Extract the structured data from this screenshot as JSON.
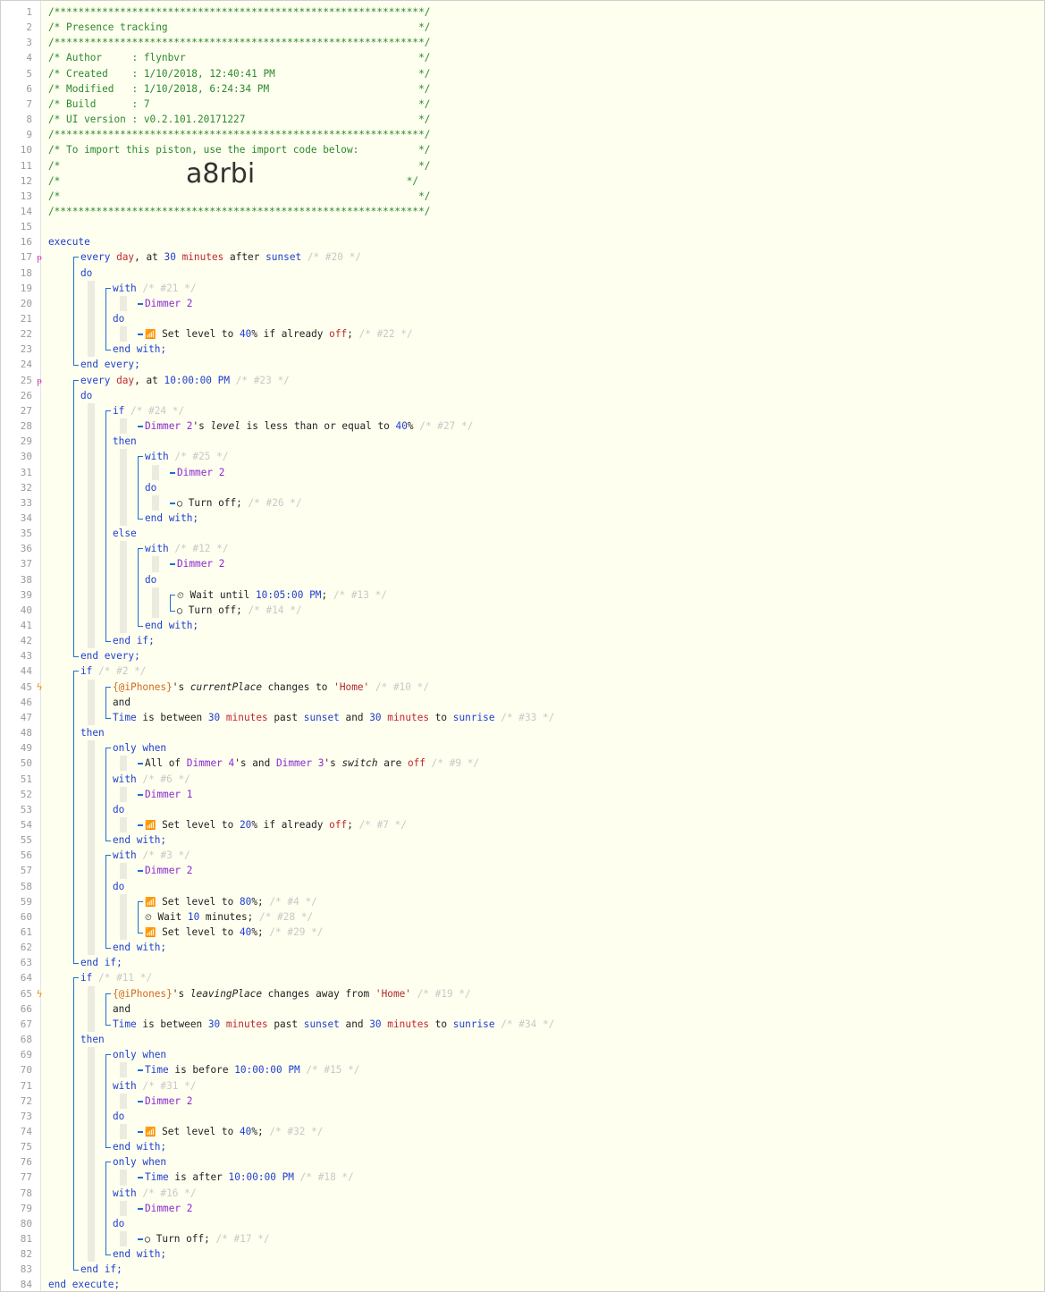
{
  "colors": {
    "bg": "#fffff0",
    "comment": "#2a8a2a",
    "keyword": "#1f3fcf",
    "device": "#8a2ad0",
    "value": "#c0272d",
    "variable": "#d06a1c",
    "dim": "#c8c8c8",
    "bracket": "#1f6fcf"
  },
  "import_code": "a8rbi",
  "lines": [
    {
      "n": "1",
      "i": 0,
      "t": [
        [
          "cm",
          "/**************************************************************/"
        ]
      ]
    },
    {
      "n": "2",
      "i": 0,
      "t": [
        [
          "cm",
          "/* Presence tracking                                          */"
        ]
      ]
    },
    {
      "n": "3",
      "i": 0,
      "t": [
        [
          "cm",
          "/**************************************************************/"
        ]
      ]
    },
    {
      "n": "4",
      "i": 0,
      "t": [
        [
          "cm",
          "/* Author     : flynbvr                                       */"
        ]
      ]
    },
    {
      "n": "5",
      "i": 0,
      "t": [
        [
          "cm",
          "/* Created    : 1/10/2018, 12:40:41 PM                        */"
        ]
      ]
    },
    {
      "n": "6",
      "i": 0,
      "t": [
        [
          "cm",
          "/* Modified   : 1/10/2018, 6:24:34 PM                         */"
        ]
      ]
    },
    {
      "n": "7",
      "i": 0,
      "t": [
        [
          "cm",
          "/* Build      : 7                                             */"
        ]
      ]
    },
    {
      "n": "8",
      "i": 0,
      "t": [
        [
          "cm",
          "/* UI version : v0.2.101.20171227                             */"
        ]
      ]
    },
    {
      "n": "9",
      "i": 0,
      "t": [
        [
          "cm",
          "/**************************************************************/"
        ]
      ]
    },
    {
      "n": "10",
      "i": 0,
      "t": [
        [
          "cm",
          "/* To import this piston, use the import code below:          */"
        ]
      ]
    },
    {
      "n": "11",
      "i": 0,
      "t": [
        [
          "cm",
          "/*                                                            */"
        ]
      ]
    },
    {
      "n": "12",
      "i": 0,
      "big": true,
      "t": [
        [
          "cm",
          "/*"
        ],
        [
          "cm",
          "                                                          */"
        ]
      ]
    },
    {
      "n": "13",
      "i": 0,
      "t": [
        [
          "cm",
          "/*                                                            */"
        ]
      ]
    },
    {
      "n": "14",
      "i": 0,
      "t": [
        [
          "cm",
          "/**************************************************************/"
        ]
      ]
    },
    {
      "n": "15",
      "i": 0,
      "t": []
    },
    {
      "n": "16",
      "i": 0,
      "t": [
        [
          "kw",
          "execute"
        ]
      ]
    },
    {
      "n": "17",
      "i": 1,
      "m": "p",
      "t": [
        [
          "kw",
          "every "
        ],
        [
          "val",
          "day"
        ],
        [
          "txt",
          ", at "
        ],
        [
          "num",
          "30"
        ],
        [
          "txt",
          " "
        ],
        [
          "val",
          "minutes"
        ],
        [
          "txt",
          " after "
        ],
        [
          "kw",
          "sunset"
        ],
        [
          "dim",
          " /* #20 */"
        ]
      ]
    },
    {
      "n": "18",
      "i": 1,
      "t": [
        [
          "kw",
          "do"
        ]
      ]
    },
    {
      "n": "19",
      "i": 2,
      "t": [
        [
          "kw",
          "with"
        ],
        [
          "dim",
          " /* #21 */"
        ]
      ]
    },
    {
      "n": "20",
      "i": 3,
      "t": [
        [
          "dev",
          "Dimmer 2"
        ]
      ]
    },
    {
      "n": "21",
      "i": 2,
      "t": [
        [
          "kw",
          "do"
        ]
      ]
    },
    {
      "n": "22",
      "i": 3,
      "t": [
        [
          "ico",
          "📶"
        ],
        [
          "txt",
          " Set level to "
        ],
        [
          "num",
          "40"
        ],
        [
          "txt",
          "% if already "
        ],
        [
          "val",
          "off"
        ],
        [
          "txt",
          ";"
        ],
        [
          "dim",
          " /* #22 */"
        ]
      ]
    },
    {
      "n": "23",
      "i": 2,
      "t": [
        [
          "kw",
          "end with;"
        ]
      ]
    },
    {
      "n": "24",
      "i": 1,
      "t": [
        [
          "kw",
          "end every;"
        ]
      ]
    },
    {
      "n": "25",
      "i": 1,
      "m": "p",
      "t": [
        [
          "kw",
          "every "
        ],
        [
          "val",
          "day"
        ],
        [
          "txt",
          ", at "
        ],
        [
          "num",
          "10:00:00 PM"
        ],
        [
          "dim",
          " /* #23 */"
        ]
      ]
    },
    {
      "n": "26",
      "i": 1,
      "t": [
        [
          "kw",
          "do"
        ]
      ]
    },
    {
      "n": "27",
      "i": 2,
      "t": [
        [
          "kw",
          "if"
        ],
        [
          "dim",
          " /* #24 */"
        ]
      ]
    },
    {
      "n": "28",
      "i": 3,
      "t": [
        [
          "dev",
          "Dimmer 2"
        ],
        [
          "txt",
          "'s "
        ],
        [
          "attr",
          "level"
        ],
        [
          "txt",
          " is less than or equal to "
        ],
        [
          "num",
          "40"
        ],
        [
          "txt",
          "%"
        ],
        [
          "dim",
          " /* #27 */"
        ]
      ]
    },
    {
      "n": "29",
      "i": 2,
      "t": [
        [
          "kw",
          "then"
        ]
      ]
    },
    {
      "n": "30",
      "i": 3,
      "t": [
        [
          "kw",
          "with"
        ],
        [
          "dim",
          " /* #25 */"
        ]
      ]
    },
    {
      "n": "31",
      "i": 4,
      "t": [
        [
          "dev",
          "Dimmer 2"
        ]
      ]
    },
    {
      "n": "32",
      "i": 3,
      "t": [
        [
          "kw",
          "do"
        ]
      ]
    },
    {
      "n": "33",
      "i": 4,
      "t": [
        [
          "ico",
          "◯"
        ],
        [
          "txt",
          " Turn off;"
        ],
        [
          "dim",
          " /* #26 */"
        ]
      ]
    },
    {
      "n": "34",
      "i": 3,
      "t": [
        [
          "kw",
          "end with;"
        ]
      ]
    },
    {
      "n": "35",
      "i": 2,
      "t": [
        [
          "kw",
          "else"
        ]
      ]
    },
    {
      "n": "36",
      "i": 3,
      "t": [
        [
          "kw",
          "with"
        ],
        [
          "dim",
          " /* #12 */"
        ]
      ]
    },
    {
      "n": "37",
      "i": 4,
      "t": [
        [
          "dev",
          "Dimmer 2"
        ]
      ]
    },
    {
      "n": "38",
      "i": 3,
      "t": [
        [
          "kw",
          "do"
        ]
      ]
    },
    {
      "n": "39",
      "i": 4,
      "t": [
        [
          "ico",
          "⏲"
        ],
        [
          "txt",
          " Wait until "
        ],
        [
          "num",
          "10:05:00 PM"
        ],
        [
          "txt",
          ";"
        ],
        [
          "dim",
          " /* #13 */"
        ]
      ]
    },
    {
      "n": "40",
      "i": 4,
      "t": [
        [
          "ico",
          "◯"
        ],
        [
          "txt",
          " Turn off;"
        ],
        [
          "dim",
          " /* #14 */"
        ]
      ]
    },
    {
      "n": "41",
      "i": 3,
      "t": [
        [
          "kw",
          "end with;"
        ]
      ]
    },
    {
      "n": "42",
      "i": 2,
      "t": [
        [
          "kw",
          "end if;"
        ]
      ]
    },
    {
      "n": "43",
      "i": 1,
      "t": [
        [
          "kw",
          "end every;"
        ]
      ]
    },
    {
      "n": "44",
      "i": 1,
      "t": [
        [
          "kw",
          "if"
        ],
        [
          "dim",
          " /* #2 */"
        ]
      ]
    },
    {
      "n": "45",
      "i": 2,
      "m": "bolt",
      "t": [
        [
          "var",
          "{@iPhones}"
        ],
        [
          "txt",
          "'s "
        ],
        [
          "attr",
          "currentPlace"
        ],
        [
          "txt",
          " changes to "
        ],
        [
          "str",
          "'Home'"
        ],
        [
          "dim",
          " /* #10 */"
        ]
      ]
    },
    {
      "n": "46",
      "i": 2,
      "t": [
        [
          "txt",
          "and"
        ]
      ]
    },
    {
      "n": "47",
      "i": 2,
      "t": [
        [
          "kw",
          "Time"
        ],
        [
          "txt",
          " is between "
        ],
        [
          "num",
          "30"
        ],
        [
          "txt",
          " "
        ],
        [
          "val",
          "minutes"
        ],
        [
          "txt",
          " past "
        ],
        [
          "kw",
          "sunset"
        ],
        [
          "txt",
          " and "
        ],
        [
          "num",
          "30"
        ],
        [
          "txt",
          " "
        ],
        [
          "val",
          "minutes"
        ],
        [
          "txt",
          " to "
        ],
        [
          "kw",
          "sunrise"
        ],
        [
          "dim",
          " /* #33 */"
        ]
      ]
    },
    {
      "n": "48",
      "i": 1,
      "t": [
        [
          "kw",
          "then"
        ]
      ]
    },
    {
      "n": "49",
      "i": 2,
      "t": [
        [
          "kw",
          "only when"
        ]
      ]
    },
    {
      "n": "50",
      "i": 3,
      "t": [
        [
          "txt",
          "All of "
        ],
        [
          "dev",
          "Dimmer 4"
        ],
        [
          "txt",
          "'s and "
        ],
        [
          "dev",
          "Dimmer 3"
        ],
        [
          "txt",
          "'s "
        ],
        [
          "attr",
          "switch"
        ],
        [
          "txt",
          " are "
        ],
        [
          "val",
          "off"
        ],
        [
          "dim",
          " /* #9 */"
        ]
      ]
    },
    {
      "n": "51",
      "i": 2,
      "t": [
        [
          "kw",
          "with"
        ],
        [
          "dim",
          " /* #6 */"
        ]
      ]
    },
    {
      "n": "52",
      "i": 3,
      "t": [
        [
          "dev",
          "Dimmer 1"
        ]
      ]
    },
    {
      "n": "53",
      "i": 2,
      "t": [
        [
          "kw",
          "do"
        ]
      ]
    },
    {
      "n": "54",
      "i": 3,
      "t": [
        [
          "ico",
          "📶"
        ],
        [
          "txt",
          " Set level to "
        ],
        [
          "num",
          "20"
        ],
        [
          "txt",
          "% if already "
        ],
        [
          "val",
          "off"
        ],
        [
          "txt",
          ";"
        ],
        [
          "dim",
          " /* #7 */"
        ]
      ]
    },
    {
      "n": "55",
      "i": 2,
      "t": [
        [
          "kw",
          "end with;"
        ]
      ]
    },
    {
      "n": "56",
      "i": 2,
      "t": [
        [
          "kw",
          "with"
        ],
        [
          "dim",
          " /* #3 */"
        ]
      ]
    },
    {
      "n": "57",
      "i": 3,
      "t": [
        [
          "dev",
          "Dimmer 2"
        ]
      ]
    },
    {
      "n": "58",
      "i": 2,
      "t": [
        [
          "kw",
          "do"
        ]
      ]
    },
    {
      "n": "59",
      "i": 3,
      "t": [
        [
          "ico",
          "📶"
        ],
        [
          "txt",
          " Set level to "
        ],
        [
          "num",
          "80"
        ],
        [
          "txt",
          "%;"
        ],
        [
          "dim",
          " /* #4 */"
        ]
      ]
    },
    {
      "n": "60",
      "i": 3,
      "t": [
        [
          "ico",
          "⏲"
        ],
        [
          "txt",
          " Wait "
        ],
        [
          "num",
          "10"
        ],
        [
          "txt",
          " minutes;"
        ],
        [
          "dim",
          " /* #28 */"
        ]
      ]
    },
    {
      "n": "61",
      "i": 3,
      "t": [
        [
          "ico",
          "📶"
        ],
        [
          "txt",
          " Set level to "
        ],
        [
          "num",
          "40"
        ],
        [
          "txt",
          "%;"
        ],
        [
          "dim",
          " /* #29 */"
        ]
      ]
    },
    {
      "n": "62",
      "i": 2,
      "t": [
        [
          "kw",
          "end with;"
        ]
      ]
    },
    {
      "n": "63",
      "i": 1,
      "t": [
        [
          "kw",
          "end if;"
        ]
      ]
    },
    {
      "n": "64",
      "i": 1,
      "t": [
        [
          "kw",
          "if"
        ],
        [
          "dim",
          " /* #11 */"
        ]
      ]
    },
    {
      "n": "65",
      "i": 2,
      "m": "bolt",
      "t": [
        [
          "var",
          "{@iPhones}"
        ],
        [
          "txt",
          "'s "
        ],
        [
          "attr",
          "leavingPlace"
        ],
        [
          "txt",
          " changes away from "
        ],
        [
          "str",
          "'Home'"
        ],
        [
          "dim",
          " /* #19 */"
        ]
      ]
    },
    {
      "n": "66",
      "i": 2,
      "t": [
        [
          "txt",
          "and"
        ]
      ]
    },
    {
      "n": "67",
      "i": 2,
      "t": [
        [
          "kw",
          "Time"
        ],
        [
          "txt",
          " is between "
        ],
        [
          "num",
          "30"
        ],
        [
          "txt",
          " "
        ],
        [
          "val",
          "minutes"
        ],
        [
          "txt",
          " past "
        ],
        [
          "kw",
          "sunset"
        ],
        [
          "txt",
          " and "
        ],
        [
          "num",
          "30"
        ],
        [
          "txt",
          " "
        ],
        [
          "val",
          "minutes"
        ],
        [
          "txt",
          " to "
        ],
        [
          "kw",
          "sunrise"
        ],
        [
          "dim",
          " /* #34 */"
        ]
      ]
    },
    {
      "n": "68",
      "i": 1,
      "t": [
        [
          "kw",
          "then"
        ]
      ]
    },
    {
      "n": "69",
      "i": 2,
      "t": [
        [
          "kw",
          "only when"
        ]
      ]
    },
    {
      "n": "70",
      "i": 3,
      "t": [
        [
          "kw",
          "Time"
        ],
        [
          "txt",
          " is before "
        ],
        [
          "num",
          "10:00:00 PM"
        ],
        [
          "dim",
          " /* #15 */"
        ]
      ]
    },
    {
      "n": "71",
      "i": 2,
      "t": [
        [
          "kw",
          "with"
        ],
        [
          "dim",
          " /* #31 */"
        ]
      ]
    },
    {
      "n": "72",
      "i": 3,
      "t": [
        [
          "dev",
          "Dimmer 2"
        ]
      ]
    },
    {
      "n": "73",
      "i": 2,
      "t": [
        [
          "kw",
          "do"
        ]
      ]
    },
    {
      "n": "74",
      "i": 3,
      "t": [
        [
          "ico",
          "📶"
        ],
        [
          "txt",
          " Set level to "
        ],
        [
          "num",
          "40"
        ],
        [
          "txt",
          "%;"
        ],
        [
          "dim",
          " /* #32 */"
        ]
      ]
    },
    {
      "n": "75",
      "i": 2,
      "t": [
        [
          "kw",
          "end with;"
        ]
      ]
    },
    {
      "n": "76",
      "i": 2,
      "t": [
        [
          "kw",
          "only when"
        ]
      ]
    },
    {
      "n": "77",
      "i": 3,
      "t": [
        [
          "kw",
          "Time"
        ],
        [
          "txt",
          " is after "
        ],
        [
          "num",
          "10:00:00 PM"
        ],
        [
          "dim",
          " /* #18 */"
        ]
      ]
    },
    {
      "n": "78",
      "i": 2,
      "t": [
        [
          "kw",
          "with"
        ],
        [
          "dim",
          " /* #16 */"
        ]
      ]
    },
    {
      "n": "79",
      "i": 3,
      "t": [
        [
          "dev",
          "Dimmer 2"
        ]
      ]
    },
    {
      "n": "80",
      "i": 2,
      "t": [
        [
          "kw",
          "do"
        ]
      ]
    },
    {
      "n": "81",
      "i": 3,
      "t": [
        [
          "ico",
          "◯"
        ],
        [
          "txt",
          " Turn off;"
        ],
        [
          "dim",
          " /* #17 */"
        ]
      ]
    },
    {
      "n": "82",
      "i": 2,
      "t": [
        [
          "kw",
          "end with;"
        ]
      ]
    },
    {
      "n": "83",
      "i": 1,
      "t": [
        [
          "kw",
          "end if;"
        ]
      ]
    },
    {
      "n": "84",
      "i": 0,
      "t": [
        [
          "kw",
          "end execute;"
        ]
      ]
    }
  ]
}
